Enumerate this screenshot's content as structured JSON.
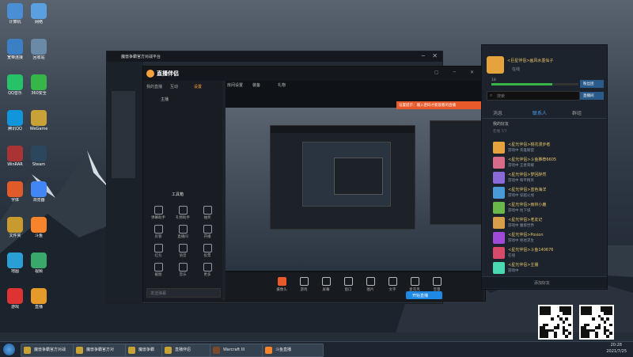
{
  "desktop": {
    "icons": [
      {
        "label": "计算机",
        "color": "#4a8fd6"
      },
      {
        "label": "宽带连接",
        "color": "#3b7fc4"
      },
      {
        "label": "QQ音乐",
        "color": "#26c267"
      },
      {
        "label": "腾讯QQ",
        "color": "#1296db"
      },
      {
        "label": "WinRAR",
        "color": "#a33"
      },
      {
        "label": "字体",
        "color": "#e05a2a"
      },
      {
        "label": "文件夹",
        "color": "#c99a2e"
      },
      {
        "label": "地图",
        "color": "#2a9fd6"
      },
      {
        "label": "游戏",
        "color": "#d33"
      },
      {
        "label": "网络",
        "color": "#5aa0e0"
      },
      {
        "label": "回收站",
        "color": "#6a8aa8"
      },
      {
        "label": "360安全",
        "color": "#36b649"
      },
      {
        "label": "WeGame",
        "color": "#c8a236"
      },
      {
        "label": "Steam",
        "color": "#2a475e"
      },
      {
        "label": "浏览器",
        "color": "#4285f4"
      },
      {
        "label": "斗鱼",
        "color": "#f7832a"
      },
      {
        "label": "视频",
        "color": "#3aa86a"
      },
      {
        "label": "直播",
        "color": "#e69a2a"
      }
    ]
  },
  "back_window": {
    "title": "魔兽争霸官方对战平台"
  },
  "main_window": {
    "title": "直播伴侣",
    "tabs": [
      "我的直播",
      "互动",
      "设置"
    ],
    "subtabs": [
      "房间设置",
      "装备",
      "礼物"
    ],
    "user": "主播",
    "tools_title": "工具箱",
    "tools": [
      "弹幕助手",
      "礼物助手",
      "抽奖",
      "房管",
      "直播间",
      "开播",
      "红包",
      "语音",
      "投票",
      "截图",
      "音乐",
      "更多"
    ],
    "bottom_tools": [
      "摄像头",
      "游戏",
      "屏幕",
      "窗口",
      "图片",
      "文字",
      "麦克风",
      "音量"
    ],
    "bottom_btn": "开始直播",
    "input_placeholder": "发送弹幕",
    "notice": "设置提示：输入密码才能观看的直播"
  },
  "chat_window": {
    "user_name": "<巨星伴侣>画风水墨仙子",
    "status": "在线",
    "level": "18",
    "search_placeholder": "搜索",
    "side_btns": [
      "粉丝团",
      "直播间"
    ],
    "tabs": [
      "消息",
      "联系人",
      "群组"
    ],
    "group_label": "我的好友",
    "group_sub": "在线 7/7",
    "contacts": [
      {
        "name": "<星光伴侣>桃花漫步者",
        "sub": "游戏中  英雄联盟",
        "color": "#e6a23c"
      },
      {
        "name": "<星光伴侣>斗鱼推荐6605",
        "sub": "游戏中  王者荣耀",
        "color": "#d86a8a"
      },
      {
        "name": "<星光伴侣>梦回醉然",
        "sub": "游戏中  和平精英",
        "color": "#8a6ad8"
      },
      {
        "name": "<星光伴侣>蓝色海洋",
        "sub": "游戏中  穿越火线",
        "color": "#4a9ad8"
      },
      {
        "name": "<星光伴侣>雨林小鹿",
        "sub": "游戏中  地下城",
        "color": "#6ab84a"
      },
      {
        "name": "<星光伴侣>老友记",
        "sub": "游戏中  魔兽世界",
        "color": "#d8a04a"
      },
      {
        "name": "<星光伴侣>Posion",
        "sub": "游戏中  绝地求生",
        "color": "#a04ad8"
      },
      {
        "name": "<星光伴侣>斗鱼140676",
        "sub": "在线",
        "color": "#d84a6a"
      },
      {
        "name": "<星光伴侣>主播",
        "sub": "游戏中",
        "color": "#4ad8b0"
      }
    ],
    "bottom": "添加好友"
  },
  "taskbar": {
    "items": [
      {
        "label": "魔兽争霸官方对战",
        "color": "#c8a236"
      },
      {
        "label": "魔兽争霸官方对",
        "color": "#c8a236"
      },
      {
        "label": "魔兽争霸",
        "color": "#c8a236"
      },
      {
        "label": "直播伴侣",
        "color": "#c8a236"
      },
      {
        "label": "Warcraft III",
        "color": "#7a4a2a"
      },
      {
        "label": "斗鱼直播",
        "color": "#f7832a"
      }
    ],
    "time": "20:28",
    "date": "2021/7/25"
  }
}
